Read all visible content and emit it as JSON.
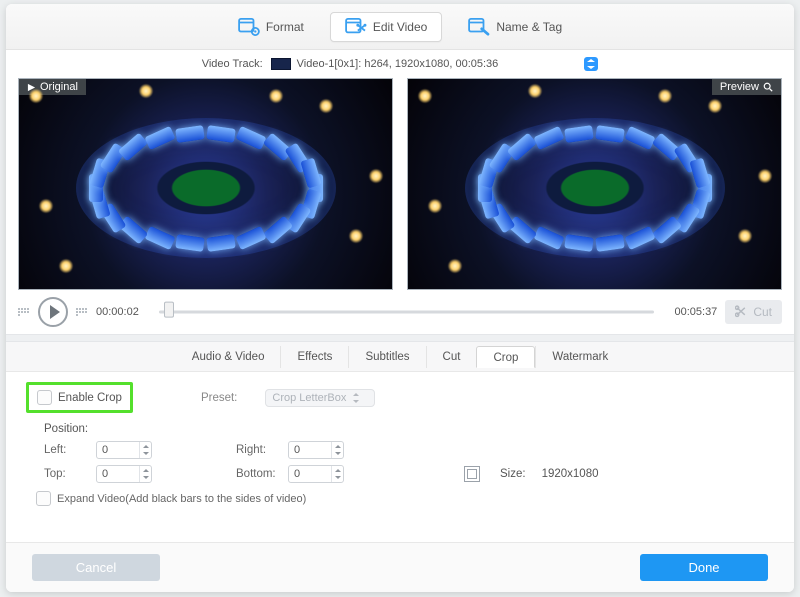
{
  "top_tabs": {
    "format": "Format",
    "edit": "Edit Video",
    "name": "Name & Tag",
    "active": "edit"
  },
  "track": {
    "label": "Video Track:",
    "selected": "Video-1[0x1]: h264, 1920x1080, 00:05:36"
  },
  "pane_labels": {
    "original": "Original",
    "preview": "Preview"
  },
  "transport": {
    "current": "00:00:02",
    "total": "00:05:37",
    "cut_label": "Cut",
    "position_pct": 2
  },
  "sub_tabs": {
    "audio_video": "Audio & Video",
    "effects": "Effects",
    "subtitles": "Subtitles",
    "cut": "Cut",
    "crop": "Crop",
    "watermark": "Watermark",
    "active": "crop"
  },
  "crop": {
    "enable_label": "Enable Crop",
    "enabled": false,
    "preset_label": "Preset:",
    "preset_value": "Crop LetterBox",
    "position_label": "Position:",
    "left_label": "Left:",
    "left": "0",
    "right_label": "Right:",
    "right": "0",
    "top_label": "Top:",
    "top": "0",
    "bottom_label": "Bottom:",
    "bottom": "0",
    "size_label": "Size:",
    "size_value": "1920x1080",
    "expand_label": "Expand Video(Add black bars to the sides of video)",
    "expand": false
  },
  "footer": {
    "cancel": "Cancel",
    "done": "Done"
  }
}
